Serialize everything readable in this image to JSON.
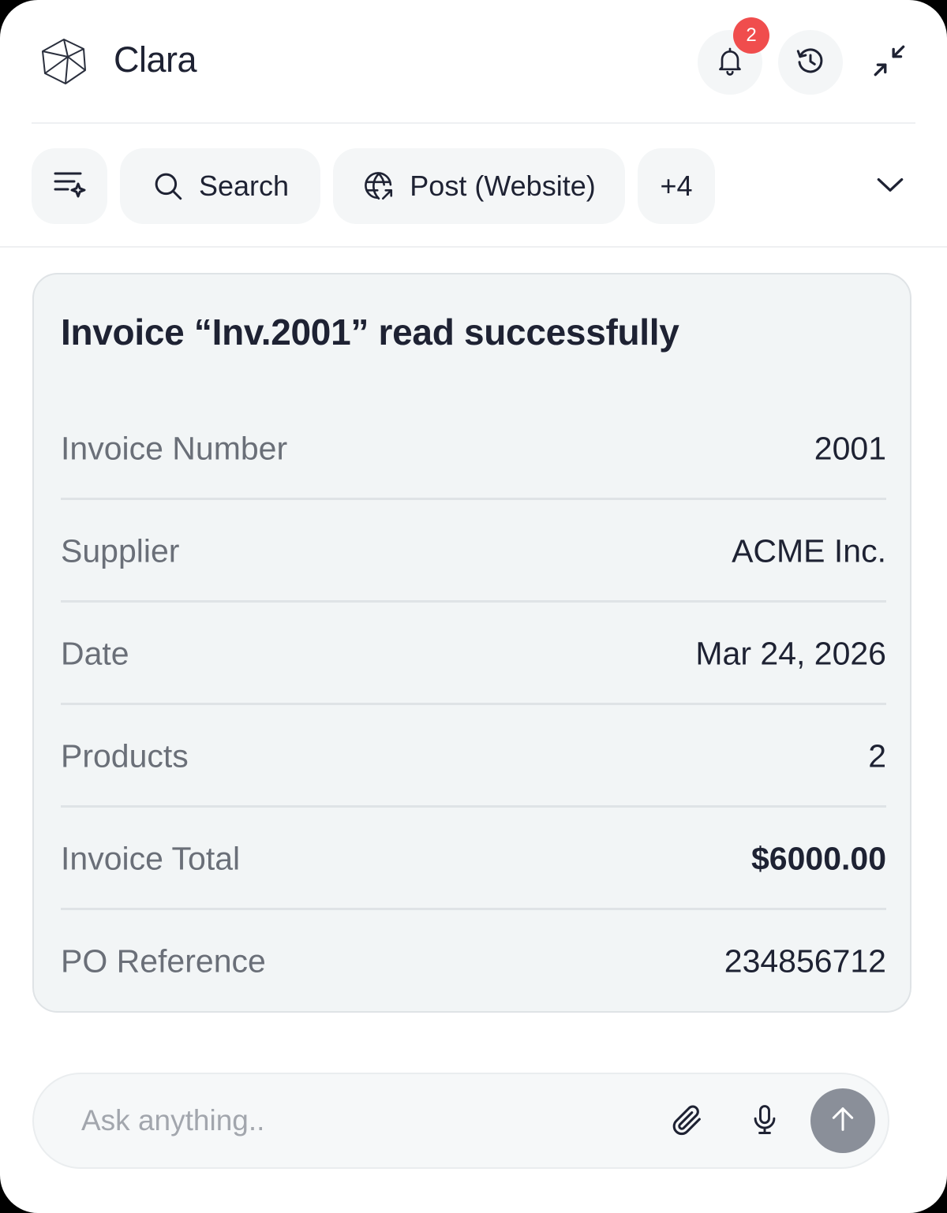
{
  "header": {
    "app_name": "Clara",
    "notification_count": "2",
    "icons": [
      "logo-icon",
      "bell-icon",
      "history-icon",
      "collapse-icon"
    ]
  },
  "toolbar": {
    "search_label": "Search",
    "post_label": "Post (Website)",
    "more_label": "+4",
    "icons": [
      "filter-sparkle-icon",
      "search-icon",
      "globe-link-icon",
      "chevron-down-icon"
    ]
  },
  "card": {
    "title": "Invoice “Inv.2001” read successfully",
    "rows": [
      {
        "label": "Invoice Number",
        "value": "2001"
      },
      {
        "label": "Supplier",
        "value": "ACME Inc."
      },
      {
        "label": "Date",
        "value": "Mar 24, 2026"
      },
      {
        "label": "Products",
        "value": "2"
      },
      {
        "label": "Invoice Total",
        "value": "$6000.00"
      },
      {
        "label": "PO Reference",
        "value": "234856712"
      }
    ]
  },
  "composer": {
    "placeholder": "Ask anything..",
    "icons": [
      "paperclip-icon",
      "microphone-icon",
      "arrow-up-icon"
    ]
  },
  "colors": {
    "badge": "#f04d4d",
    "send_button": "#8a8f99",
    "card_background": "#f2f5f6"
  }
}
